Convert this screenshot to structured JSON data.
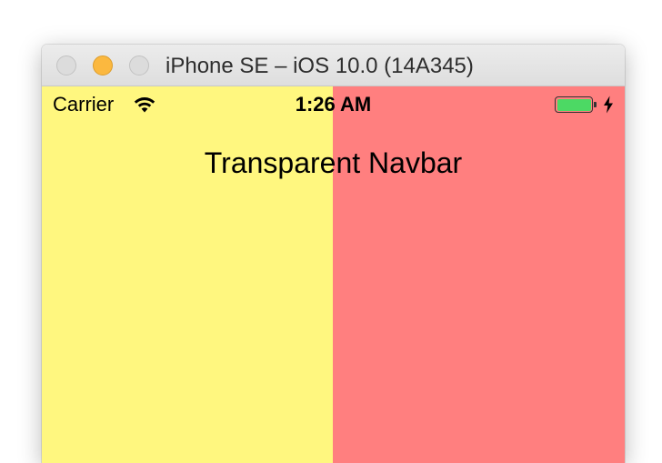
{
  "window": {
    "title": "iPhone SE – iOS 10.0 (14A345)"
  },
  "statusbar": {
    "carrier": "Carrier",
    "time": "1:26 AM",
    "wifi_icon": "wifi-icon",
    "battery_icon": "battery-icon",
    "charging_icon": "charging-bolt-icon"
  },
  "navbar": {
    "title": "Transparent Navbar"
  },
  "colors": {
    "left_panel": "#fff77f",
    "right_panel": "#ff7f7f",
    "battery_fill": "#4cd964",
    "minimize_button": "#fbb83f"
  }
}
